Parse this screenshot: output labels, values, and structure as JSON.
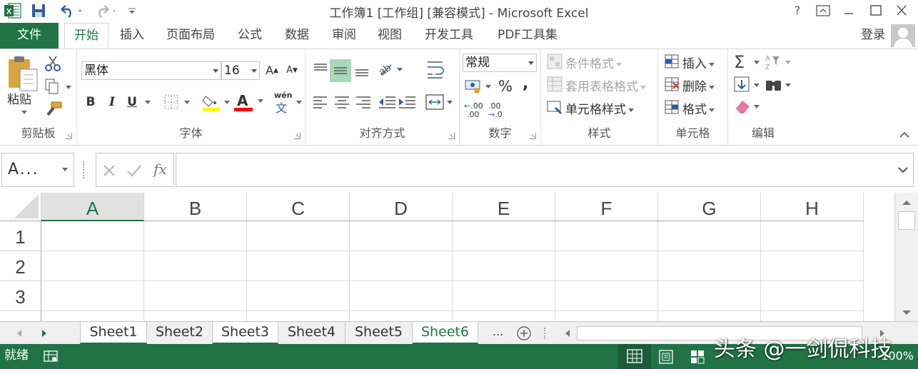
{
  "window": {
    "title": "工作簿1  [工作组]  [兼容模式] - Microsoft Excel",
    "help": "?",
    "controls": [
      "restore",
      "minimize",
      "maximize",
      "close"
    ]
  },
  "colors": {
    "accent": "#217346",
    "selected_fill": "#a9d8b8"
  },
  "ribbon_tabs": {
    "file": "文件",
    "items": [
      "开始",
      "插入",
      "页面布局",
      "公式",
      "数据",
      "审阅",
      "视图",
      "开发工具",
      "PDF工具集"
    ],
    "active": "开始",
    "login": "登录"
  },
  "clipboard": {
    "paste": "粘贴",
    "label": "剪贴板"
  },
  "font": {
    "name": "黑体",
    "size": "16",
    "bold": "B",
    "italic": "I",
    "underline": "U",
    "grow": "A",
    "shrink": "A",
    "color_letter": "A",
    "phonetic_top": "wén",
    "phonetic_bottom": "文",
    "label": "字体"
  },
  "alignment": {
    "label": "对齐方式"
  },
  "number": {
    "format": "常规",
    "percent": "%",
    "comma": ",",
    "inc_decimal": ".00",
    "dec_decimal": ".00",
    "label": "数字"
  },
  "styles": {
    "conditional": "条件格式",
    "table": "套用表格格式",
    "cell_styles": "单元格样式",
    "label": "样式"
  },
  "cells": {
    "insert": "插入",
    "delete": "删除",
    "format": "格式",
    "label": "单元格"
  },
  "editing": {
    "label": "编辑"
  },
  "formula_bar": {
    "name_box": "A...",
    "fx": "fx",
    "value": ""
  },
  "sheet": {
    "columns": [
      "A",
      "B",
      "C",
      "D",
      "E",
      "F",
      "G",
      "H"
    ],
    "selected_column": "A",
    "rows": [
      "1",
      "2",
      "3"
    ]
  },
  "sheet_tabs": {
    "tabs": [
      "Sheet1",
      "Sheet2",
      "Sheet3",
      "Sheet4",
      "Sheet5",
      "Sheet6"
    ],
    "active": "Sheet6",
    "more": "..."
  },
  "status": {
    "ready": "就绪",
    "zoom": "100%"
  },
  "watermark": "头条 @一剑侃科技"
}
